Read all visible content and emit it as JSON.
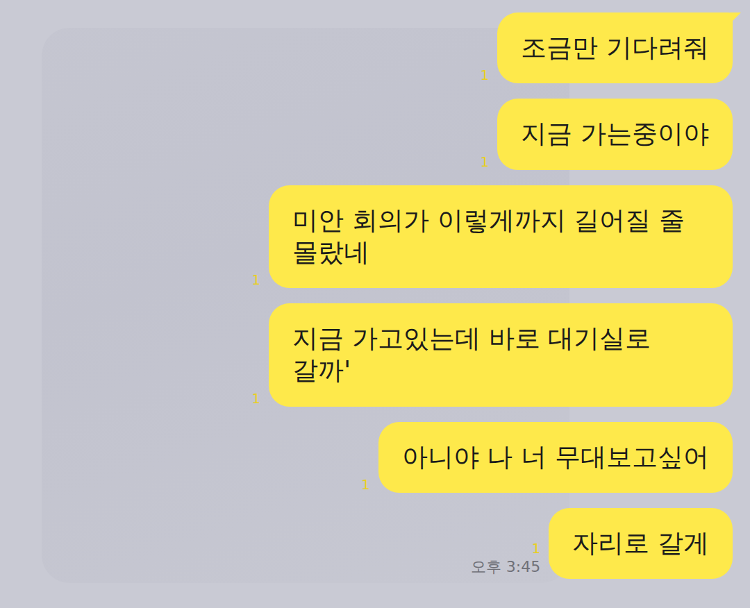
{
  "chat": {
    "messages": [
      {
        "text": "조금만 기다려줘",
        "unread": "1",
        "tail": true
      },
      {
        "text": "지금 가는중이야",
        "unread": "1",
        "tail": false
      },
      {
        "text": "미안 회의가 이렇게까지 길어질 줄 몰랐네",
        "unread": "1",
        "tail": false
      },
      {
        "text": "지금 가고있는데 바로 대기실로 갈까'",
        "unread": "1",
        "tail": false
      },
      {
        "text": "아니야 나 너 무대보고싶어",
        "unread": "1",
        "tail": false
      },
      {
        "text": "자리로 갈게",
        "unread": "1",
        "tail": false,
        "time": "오후 3:45"
      }
    ]
  }
}
